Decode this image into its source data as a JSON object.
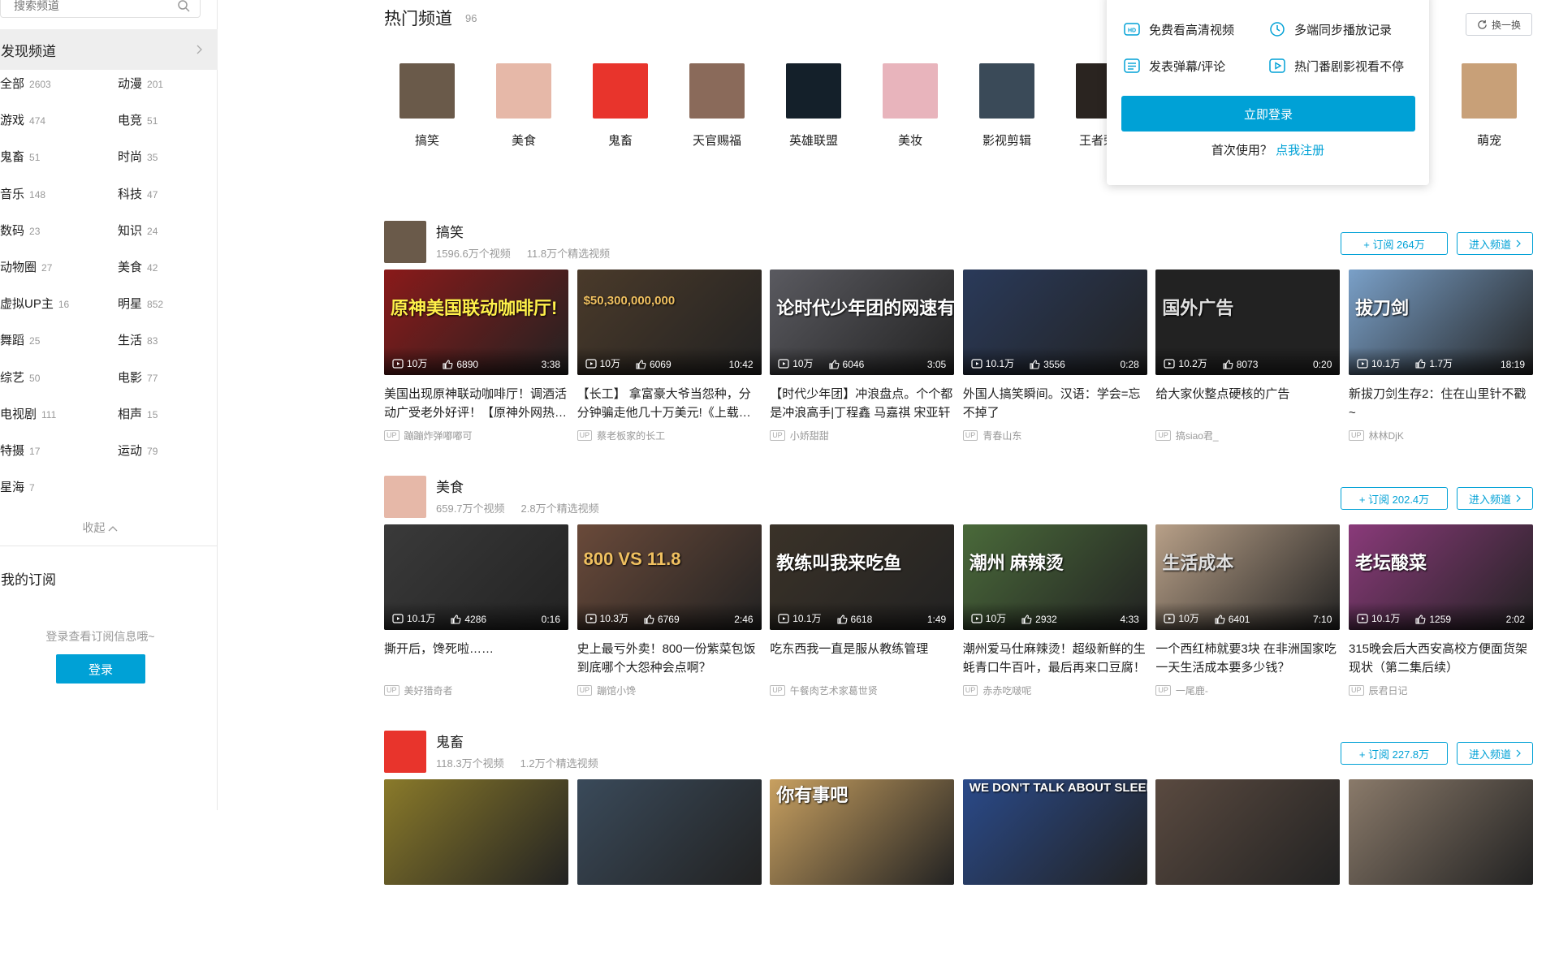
{
  "sidebar": {
    "search_placeholder": "搜索频道",
    "discover_label": "发现频道",
    "categories": [
      {
        "name": "全部",
        "count": "2603"
      },
      {
        "name": "动漫",
        "count": "201"
      },
      {
        "name": "游戏",
        "count": "474"
      },
      {
        "name": "电竞",
        "count": "51"
      },
      {
        "name": "鬼畜",
        "count": "51"
      },
      {
        "name": "时尚",
        "count": "35"
      },
      {
        "name": "音乐",
        "count": "148"
      },
      {
        "name": "科技",
        "count": "47"
      },
      {
        "name": "数码",
        "count": "23"
      },
      {
        "name": "知识",
        "count": "24"
      },
      {
        "name": "动物圈",
        "count": "27"
      },
      {
        "name": "美食",
        "count": "42"
      },
      {
        "name": "虚拟UP主",
        "count": "16"
      },
      {
        "name": "明星",
        "count": "852"
      },
      {
        "name": "舞蹈",
        "count": "25"
      },
      {
        "name": "生活",
        "count": "83"
      },
      {
        "name": "综艺",
        "count": "50"
      },
      {
        "name": "电影",
        "count": "77"
      },
      {
        "name": "电视剧",
        "count": "111"
      },
      {
        "name": "相声",
        "count": "15"
      },
      {
        "name": "特摄",
        "count": "17"
      },
      {
        "name": "运动",
        "count": "79"
      },
      {
        "name": "星海",
        "count": "7"
      }
    ],
    "collapse_label": "收起",
    "my_sub_label": "我的订阅",
    "login_hint": "登录查看订阅信息哦~",
    "login_button": "登录"
  },
  "hot": {
    "title": "热门频道",
    "count": "96",
    "refresh_label": "换一换",
    "channels": [
      {
        "label": "搞笑",
        "color": "#6a5a4a"
      },
      {
        "label": "美食",
        "color": "#e6b8a8"
      },
      {
        "label": "鬼畜",
        "color": "#e8342c"
      },
      {
        "label": "天官赐福",
        "color": "#8a6a5a"
      },
      {
        "label": "英雄联盟",
        "color": "#14202a"
      },
      {
        "label": "美妆",
        "color": "#e8b4bc"
      },
      {
        "label": "影视剪辑",
        "color": "#3a4a58"
      },
      {
        "label": "王者荣耀",
        "color": "#2a2420"
      },
      {
        "label": "萌宠",
        "color": "#c8a078"
      }
    ]
  },
  "popup": {
    "features": [
      "免费看高清视频",
      "多端同步播放记录",
      "发表弹幕/评论",
      "热门番剧影视看不停"
    ],
    "login_button": "立即登录",
    "first_use": "首次使用？",
    "register_link": "点我注册"
  },
  "sections": [
    {
      "name": "搞笑",
      "videos": "1596.6万个视频",
      "featured": "11.8万个精选视频",
      "subscribe": "+ 订阅 264万",
      "enter": "进入频道",
      "cards": [
        {
          "views": "10万",
          "likes": "6890",
          "duration": "3:38",
          "title": "美国出现原神联动咖啡厅！调酒活动广受老外好评！【原神外网热议】",
          "up": "蹦蹦炸弹嘟嘟可",
          "bg": "#8a1a1a",
          "text": "原神美国联动咖啡厅!"
        },
        {
          "views": "10万",
          "likes": "6069",
          "duration": "10:42",
          "title": "【长工】 拿富豪大爷当怨种，分分钟骗走他几十万美元!《上载新生》",
          "up": "蔡老板家的长工",
          "bg": "#4a3a2a",
          "text": "$50,300,000,000"
        },
        {
          "views": "10万",
          "likes": "6046",
          "duration": "3:05",
          "title": "【时代少年团】冲浪盘点。个个都是冲浪高手|丁程鑫 马嘉祺 宋亚轩",
          "up": "小娇甜甜",
          "bg": "#5a5a60",
          "text": "论时代少年团的网速有多快"
        },
        {
          "views": "10.1万",
          "likes": "3556",
          "duration": "0:28",
          "title": "外国人搞笑瞬间。汉语：学会=忘不掉了",
          "up": "青春山东",
          "bg": "#2a3a5a",
          "text": ""
        },
        {
          "views": "10.2万",
          "likes": "8073",
          "duration": "0:20",
          "title": "给大家伙整点硬核的广告",
          "up": "搞siao君_",
          "bg": "#222222",
          "text": "国外广告"
        },
        {
          "views": "10.1万",
          "likes": "1.7万",
          "duration": "18:19",
          "title": "新拔刀剑生存2：住在山里针不戳~",
          "up": "林林DjK",
          "bg": "#7aa0c8",
          "text": "拔刀剑"
        }
      ]
    },
    {
      "name": "美食",
      "videos": "659.7万个视频",
      "featured": "2.8万个精选视频",
      "subscribe": "+ 订阅 202.4万",
      "enter": "进入频道",
      "cards": [
        {
          "views": "10.1万",
          "likes": "4286",
          "duration": "0:16",
          "title": "撕开后，馋死啦……",
          "up": "美好猎奇者",
          "bg": "#3a3a3a",
          "text": ""
        },
        {
          "views": "10.3万",
          "likes": "6769",
          "duration": "2:46",
          "title": "史上最亏外卖！800一份紫菜包饭到底哪个大怨种会点啊？",
          "up": "蹦馆小馋",
          "bg": "#6a4a3a",
          "text": "800 VS 11.8"
        },
        {
          "views": "10.1万",
          "likes": "6618",
          "duration": "1:49",
          "title": "吃东西我一直是服从教练管理",
          "up": "午餐肉艺术家葛世贤",
          "bg": "#3a3228",
          "text": "教练叫我来吃鱼"
        },
        {
          "views": "10万",
          "likes": "2932",
          "duration": "4:33",
          "title": "潮州爱马仕麻辣烫！超级新鲜的生蚝青口牛百叶，最后再来口豆腐！",
          "up": "赤赤吃啵呢",
          "bg": "#4a6a3a",
          "text": "潮州 麻辣烫"
        },
        {
          "views": "10万",
          "likes": "6401",
          "duration": "7:10",
          "title": "一个西红柿就要3块 在非洲国家吃一天生活成本要多少钱？",
          "up": "一尾鹿-",
          "bg": "#b8a088",
          "text": "生活成本"
        },
        {
          "views": "10.1万",
          "likes": "1259",
          "duration": "2:02",
          "title": "315晚会后大西安高校方便面货架现状（第二集后续）",
          "up": "辰君日记",
          "bg": "#8a3a7a",
          "text": "老坛酸菜"
        }
      ]
    },
    {
      "name": "鬼畜",
      "videos": "118.3万个视频",
      "featured": "1.2万个精选视频",
      "subscribe": "+ 订阅 227.8万",
      "enter": "进入频道",
      "cards": [
        {
          "bg": "#8a7a2a",
          "text": ""
        },
        {
          "bg": "#3a4a5a",
          "text": ""
        },
        {
          "bg": "#c8a060",
          "text": "你有事吧"
        },
        {
          "bg": "#2a4a8a",
          "text": "WE DON'T TALK ABOUT SLEEPY JOE"
        },
        {
          "bg": "#5a4a40",
          "text": ""
        },
        {
          "bg": "#8a7a6a",
          "text": ""
        }
      ]
    }
  ]
}
